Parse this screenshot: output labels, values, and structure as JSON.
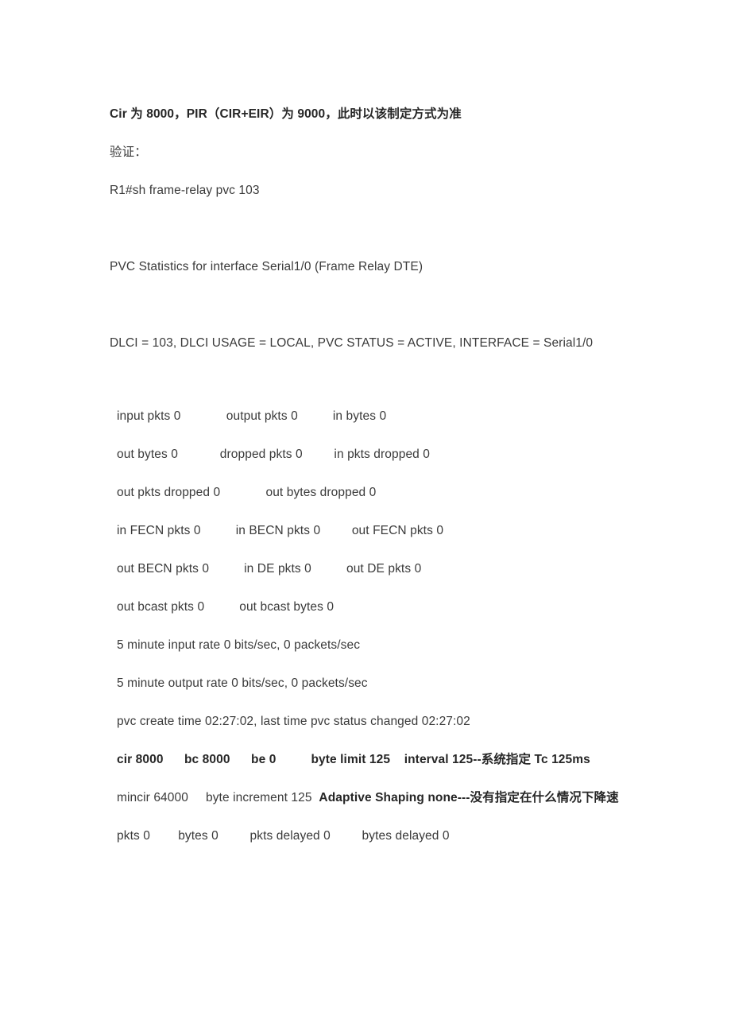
{
  "document": {
    "heading": "Cir 为 8000，PIR（CIR+EIR）为 9000，此时以该制定方式为准",
    "verify_label": "验证：",
    "command": "R1#sh frame-relay pvc 103",
    "pvc_header": "PVC Statistics for interface Serial1/0 (Frame Relay DTE)",
    "dlci_line": "DLCI = 103, DLCI USAGE = LOCAL, PVC STATUS = ACTIVE, INTERFACE = Serial1/0",
    "stats_rows": [
      "input pkts 0             output pkts 0          in bytes 0",
      "out bytes 0            dropped pkts 0         in pkts dropped 0",
      "out pkts dropped 0             out bytes dropped 0",
      "in FECN pkts 0          in BECN pkts 0         out FECN pkts 0",
      "out BECN pkts 0          in DE pkts 0          out DE pkts 0",
      "out bcast pkts 0          out bcast bytes 0",
      "5 minute input rate 0 bits/sec, 0 packets/sec",
      "5 minute output rate 0 bits/sec, 0 packets/sec",
      "pvc create time 02:27:02, last time pvc status changed 02:27:02"
    ],
    "shaping_line": "cir 8000      bc 8000      be 0          byte limit 125    interval 125--系统指定 Tc 125ms",
    "mincir_plain": "mincir 64000     byte increment 125  ",
    "mincir_bold": "Adaptive Shaping none---没有指定在什么情况下降速",
    "delay_line": "pkts 0        bytes 0         pkts delayed 0         bytes delayed 0"
  }
}
